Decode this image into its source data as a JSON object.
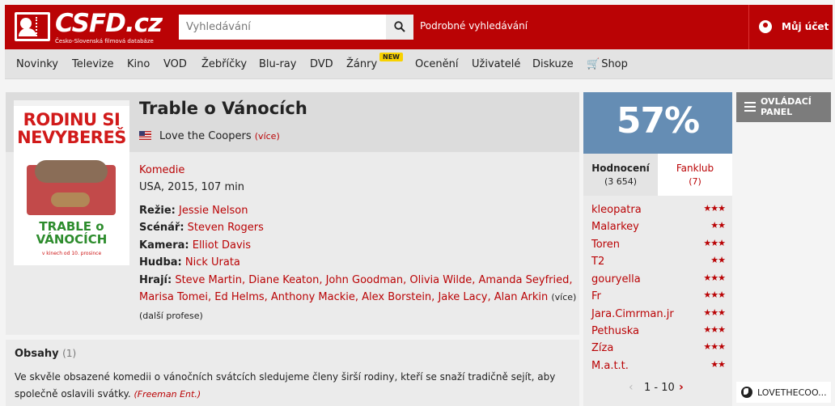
{
  "header": {
    "logo_text": "CSFD.cz",
    "logo_subtitle": "Česko-Slovenská filmová databáze",
    "search_placeholder": "Vyhledávání",
    "advanced_search": "Podrobné vyhledávání",
    "account_label": "Můj účet"
  },
  "nav": {
    "items": [
      "Novinky",
      "Televize",
      "Kino",
      "VOD",
      "Žebříčky",
      "Blu-ray",
      "DVD",
      "Žánry",
      "Ocenění",
      "Uživatelé",
      "Diskuze",
      "Shop"
    ],
    "new_badge": "NEW"
  },
  "film": {
    "poster_title": "RODINU SI NEVYBEREŠ",
    "poster_subtitle": "TRABLE o VÁNOCÍCH",
    "poster_footer": "v kinech od 10. prosince",
    "title": "Trable o Vánocích",
    "original_title": "Love the Coopers",
    "more_link": "(více)",
    "genre": "Komedie",
    "origin": "USA, 2015, 107 min",
    "credits": [
      {
        "role": "Režie:",
        "names": "Jessie Nelson"
      },
      {
        "role": "Scénář:",
        "names": "Steven Rogers"
      },
      {
        "role": "Kamera:",
        "names": "Elliot Davis"
      },
      {
        "role": "Hudba:",
        "names": "Nick Urata"
      },
      {
        "role": "Hrají:",
        "names": "Steve Martin, Diane Keaton, John Goodman, Olivia Wilde, Amanda Seyfried,"
      }
    ],
    "cast_line2": "Marisa Tomei, Ed Helms, Anthony Mackie, Alex Borstein, Jake Lacy, Alan Arkin",
    "cast_more": "(více)",
    "more_professions": "(další profese)"
  },
  "plot": {
    "title": "Obsahy",
    "count": "(1)",
    "text": "Ve skvěle obsazené komedii o vánočních svátcích sledujeme členy širší rodiny, kteří se snaží tradičně sejít, aby společně oslavili svátky.",
    "source": "(Freeman Ent.)"
  },
  "rating": {
    "value": "57%",
    "tab_ratings_label": "Hodnocení",
    "tab_ratings_count": "(3 654)",
    "tab_fanclub_label": "Fanklub",
    "tab_fanclub_count": "(7)",
    "users": [
      {
        "name": "kleopatra",
        "stars": "★★★"
      },
      {
        "name": "Malarkey",
        "stars": "★★"
      },
      {
        "name": "Toren",
        "stars": "★★★"
      },
      {
        "name": "T2",
        "stars": "★★"
      },
      {
        "name": "gouryella",
        "stars": "★★★"
      },
      {
        "name": "Fr",
        "stars": "★★★"
      },
      {
        "name": "Jara.Cimrman.jr",
        "stars": "★★★"
      },
      {
        "name": "Pethuska",
        "stars": "★★★"
      },
      {
        "name": "Zíza",
        "stars": "★★★"
      },
      {
        "name": "M.a.t.t.",
        "stars": "★★"
      }
    ],
    "pager": "1 - 10"
  },
  "sidebar": {
    "control_panel": "OVLÁDACÍ PANEL",
    "lovethe": "LOVETHECOO..."
  },
  "colors": {
    "brand_red": "#ba0305",
    "rating_blue": "#658db4"
  }
}
